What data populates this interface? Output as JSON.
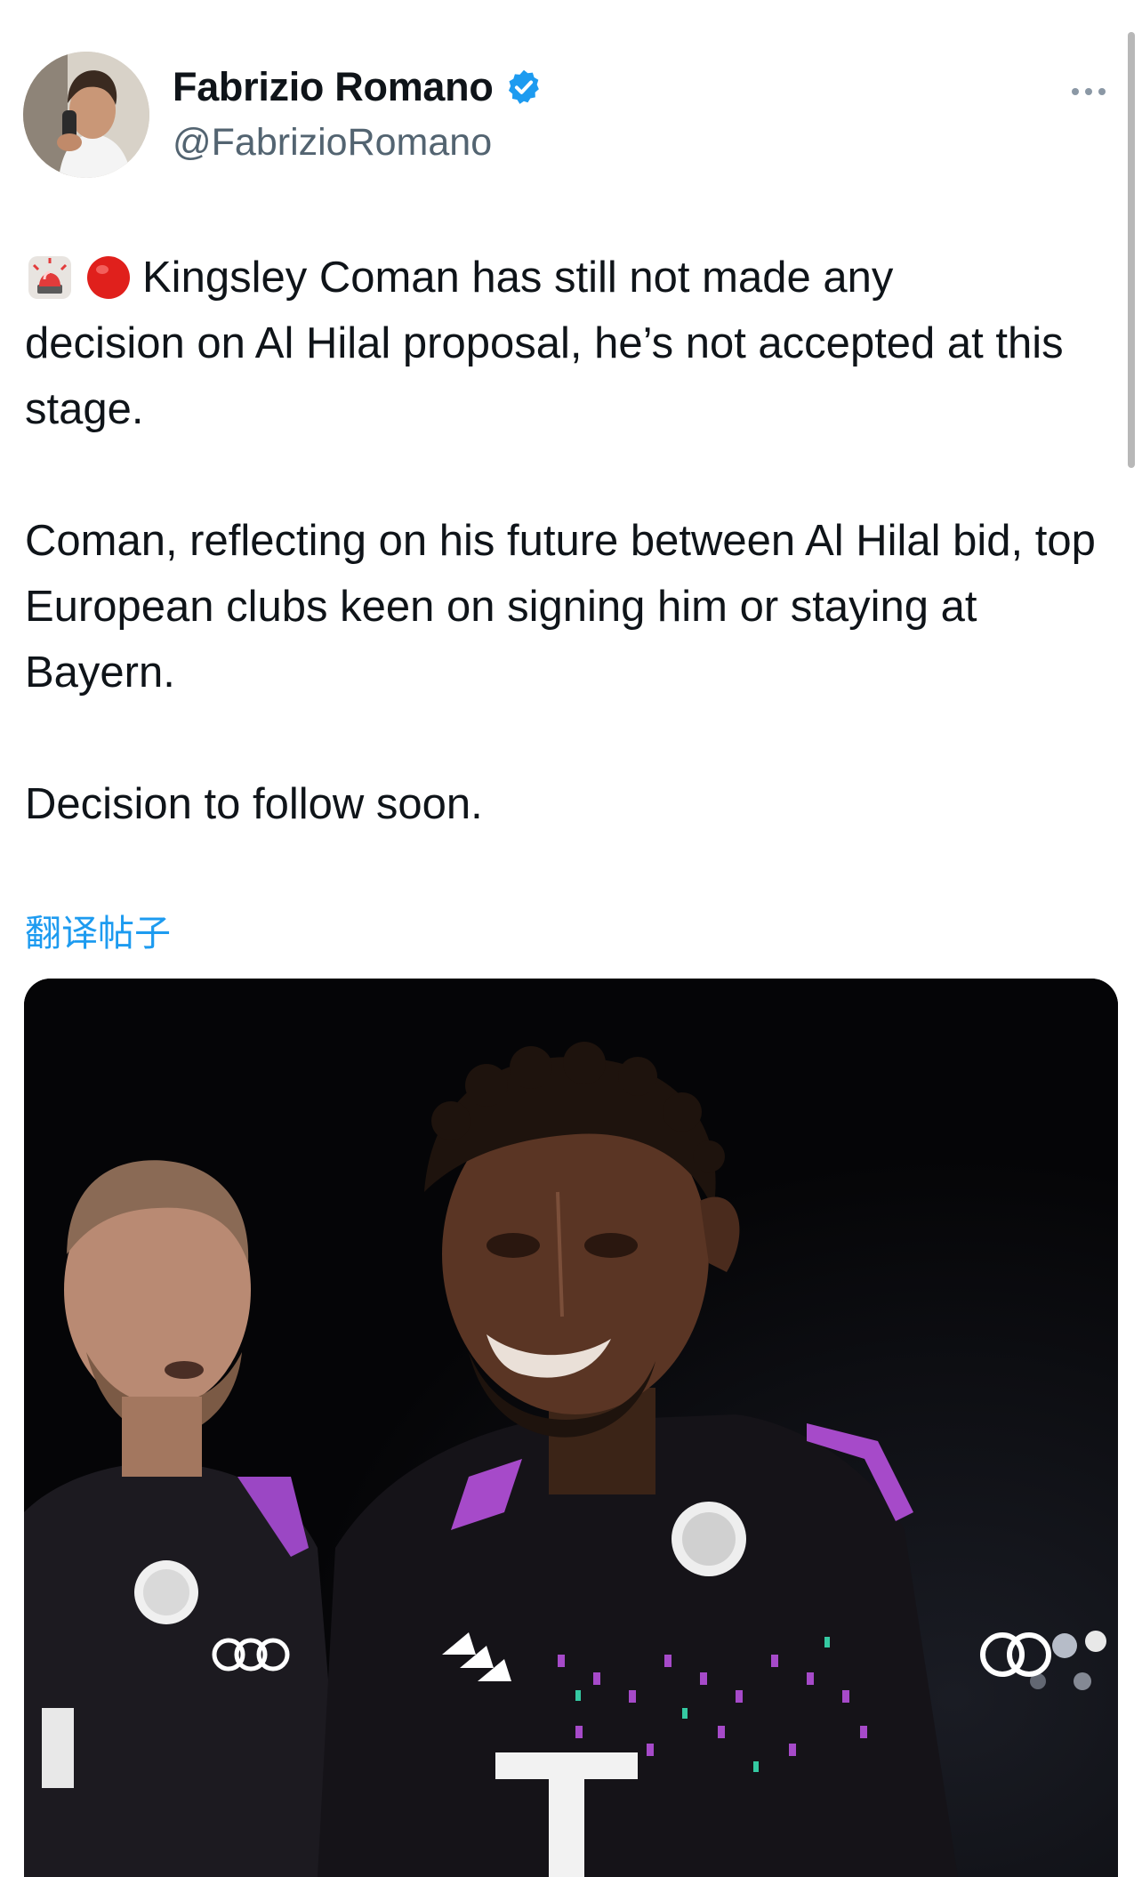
{
  "author": {
    "name": "Fabrizio Romano",
    "handle": "@FabrizioRomano",
    "verified": true
  },
  "icons": {
    "verified": "verified-badge-icon",
    "more": "more-horizontal-icon",
    "siren": "police-siren-emoji",
    "red_circle": "red-circle-emoji"
  },
  "tweet": {
    "paragraph1_line1": "Kingsley Coman has still not made any",
    "paragraph1_rest": "decision on Al Hilal proposal, he’s not accepted at this stage.",
    "paragraph2": "Coman, reflecting on his future between Al Hilal bid, top European clubs keen on signing him or staying at Bayern.",
    "paragraph3": "Decision to follow soon."
  },
  "translate_label": "翻译帖子",
  "colors": {
    "link": "#1d9bf0",
    "verified": "#1d9bf0",
    "handle": "#536471",
    "jersey_accent": "#a64ac9"
  }
}
